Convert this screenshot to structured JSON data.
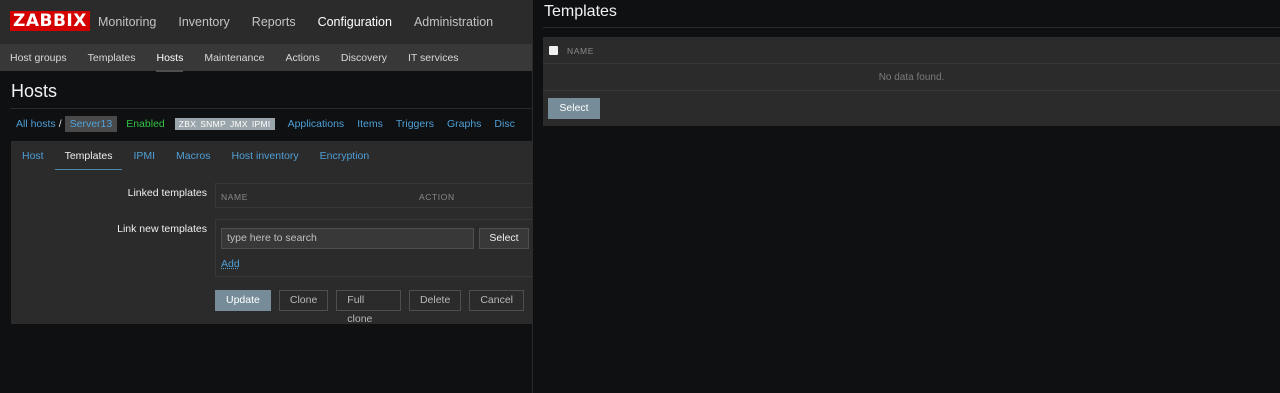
{
  "app": {
    "logo": "ZABBIX"
  },
  "main_menu": {
    "items": [
      {
        "label": "Monitoring",
        "active": false
      },
      {
        "label": "Inventory",
        "active": false
      },
      {
        "label": "Reports",
        "active": false
      },
      {
        "label": "Configuration",
        "active": true
      },
      {
        "label": "Administration",
        "active": false
      }
    ]
  },
  "sub_menu": {
    "items": [
      {
        "label": "Host groups"
      },
      {
        "label": "Templates"
      },
      {
        "label": "Hosts"
      },
      {
        "label": "Maintenance"
      },
      {
        "label": "Actions"
      },
      {
        "label": "Discovery"
      },
      {
        "label": "IT services"
      }
    ]
  },
  "page": {
    "title": "Hosts"
  },
  "breadcrumb": {
    "all_hosts": "All hosts",
    "separator": "/",
    "server": "Server13",
    "status": "Enabled",
    "tags": [
      "ZBX",
      "SNMP",
      "JMX",
      "IPMI"
    ],
    "nav": [
      "Applications",
      "Items",
      "Triggers",
      "Graphs",
      "Disc"
    ]
  },
  "tabs": [
    "Host",
    "Templates",
    "IPMI",
    "Macros",
    "Host inventory",
    "Encryption"
  ],
  "form": {
    "linked_templates_label": "Linked templates",
    "col_name": "NAME",
    "col_action": "ACTION",
    "link_new_label": "Link new templates",
    "search_placeholder": "type here to search",
    "select_label": "Select",
    "add_label": "Add"
  },
  "buttons": {
    "update": "Update",
    "clone": "Clone",
    "full_clone": "Full clone",
    "delete": "Delete",
    "cancel": "Cancel"
  },
  "popup": {
    "title": "Templates",
    "col_name": "NAME",
    "no_data": "No data found.",
    "select_label": "Select"
  },
  "colors": {
    "logo_red": "#d40000",
    "link_blue": "#4f9fd6",
    "enabled_green": "#33c244",
    "primary_button": "#768d99"
  }
}
